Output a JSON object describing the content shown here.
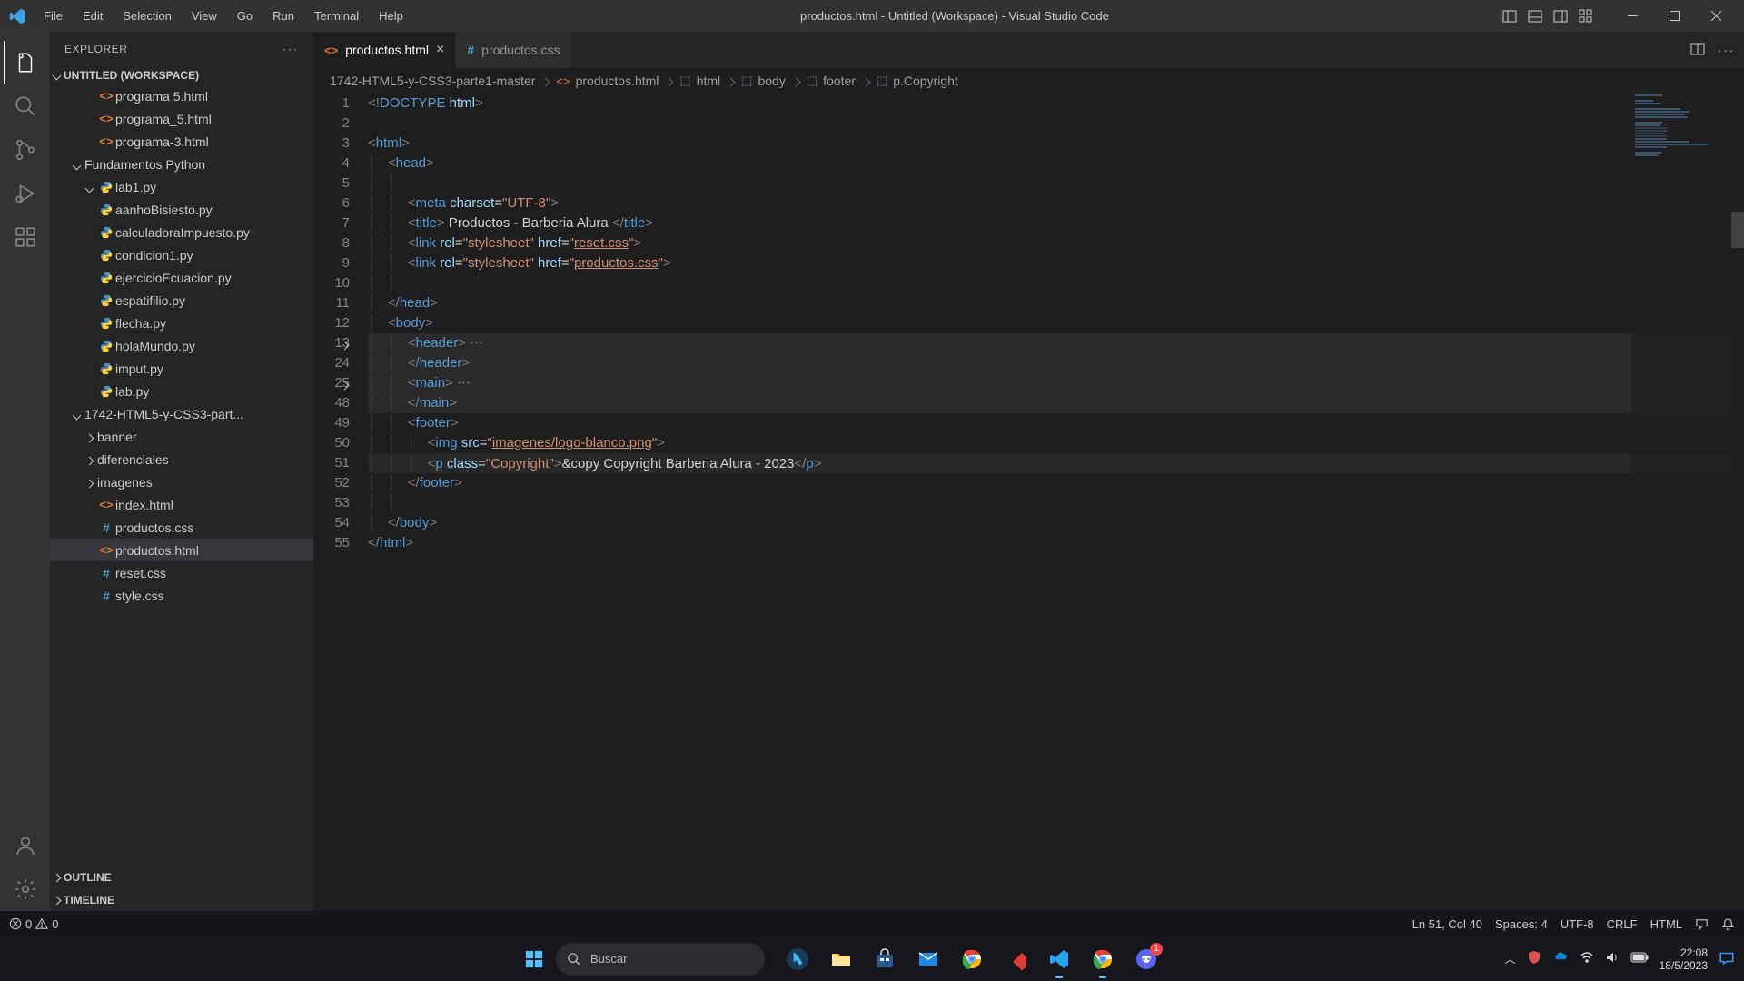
{
  "title": "productos.html - Untitled (Workspace) - Visual Studio Code",
  "menu": [
    "File",
    "Edit",
    "Selection",
    "View",
    "Go",
    "Run",
    "Terminal",
    "Help"
  ],
  "explorer": {
    "title": "EXPLORER",
    "workspace": "UNTITLED (WORKSPACE)",
    "tree": [
      {
        "depth": 2,
        "chev": "",
        "type": "html",
        "label": "programa 5.html"
      },
      {
        "depth": 2,
        "chev": "",
        "type": "html",
        "label": "programa_5.html"
      },
      {
        "depth": 2,
        "chev": "",
        "type": "html",
        "label": "programa-3.html"
      },
      {
        "depth": 1,
        "chev": "down",
        "type": "folder",
        "label": "Fundamentos Python"
      },
      {
        "depth": 2,
        "chev": "down",
        "type": "pyf",
        "label": "lab1.py"
      },
      {
        "depth": 2,
        "chev": "",
        "type": "py",
        "label": "aanhoBisiesto.py"
      },
      {
        "depth": 2,
        "chev": "",
        "type": "py",
        "label": "calculadoraImpuesto.py"
      },
      {
        "depth": 2,
        "chev": "",
        "type": "py",
        "label": "condicion1.py"
      },
      {
        "depth": 2,
        "chev": "",
        "type": "py",
        "label": "ejercicioEcuacion.py"
      },
      {
        "depth": 2,
        "chev": "",
        "type": "py",
        "label": "espatifilio.py"
      },
      {
        "depth": 2,
        "chev": "",
        "type": "py",
        "label": "flecha.py"
      },
      {
        "depth": 2,
        "chev": "",
        "type": "py",
        "label": "holaMundo.py"
      },
      {
        "depth": 2,
        "chev": "",
        "type": "py",
        "label": "imput.py"
      },
      {
        "depth": 2,
        "chev": "",
        "type": "py",
        "label": "lab.py"
      },
      {
        "depth": 1,
        "chev": "down",
        "type": "folder",
        "label": "1742-HTML5-y-CSS3-part..."
      },
      {
        "depth": 2,
        "chev": "right",
        "type": "folder",
        "label": "banner"
      },
      {
        "depth": 2,
        "chev": "right",
        "type": "folder",
        "label": "diferenciales"
      },
      {
        "depth": 2,
        "chev": "right",
        "type": "folder",
        "label": "imagenes"
      },
      {
        "depth": 2,
        "chev": "",
        "type": "html",
        "label": "index.html"
      },
      {
        "depth": 2,
        "chev": "",
        "type": "css",
        "label": "productos.css"
      },
      {
        "depth": 2,
        "chev": "",
        "type": "html",
        "label": "productos.html",
        "selected": true
      },
      {
        "depth": 2,
        "chev": "",
        "type": "css",
        "label": "reset.css"
      },
      {
        "depth": 2,
        "chev": "",
        "type": "css",
        "label": "style.css"
      }
    ],
    "outline": "OUTLINE",
    "timeline": "TIMELINE"
  },
  "tabs": [
    {
      "label": "productos.html",
      "active": true,
      "icon": "html",
      "close": true
    },
    {
      "label": "productos.css",
      "active": false,
      "icon": "css",
      "close": false
    }
  ],
  "breadcrumbs": [
    {
      "label": "1742-HTML5-y-CSS3-parte1-master",
      "icon": ""
    },
    {
      "label": "productos.html",
      "icon": "html"
    },
    {
      "label": "html",
      "icon": "sym"
    },
    {
      "label": "body",
      "icon": "sym"
    },
    {
      "label": "footer",
      "icon": "sym"
    },
    {
      "label": "p.Copyright",
      "icon": "sym"
    }
  ],
  "code_lines": [
    1,
    2,
    3,
    4,
    5,
    6,
    7,
    8,
    9,
    10,
    11,
    12,
    13,
    24,
    25,
    48,
    49,
    50,
    51,
    52,
    53,
    54,
    55
  ],
  "statusbar": {
    "errors": "0",
    "warnings": "0",
    "lncol": "Ln 51, Col 40",
    "spaces": "Spaces: 4",
    "encoding": "UTF-8",
    "eol": "CRLF",
    "lang": "HTML"
  },
  "taskbar": {
    "search_placeholder": "Buscar",
    "time": "22:08",
    "date": "18/5/2023",
    "discord_badge": "1"
  }
}
